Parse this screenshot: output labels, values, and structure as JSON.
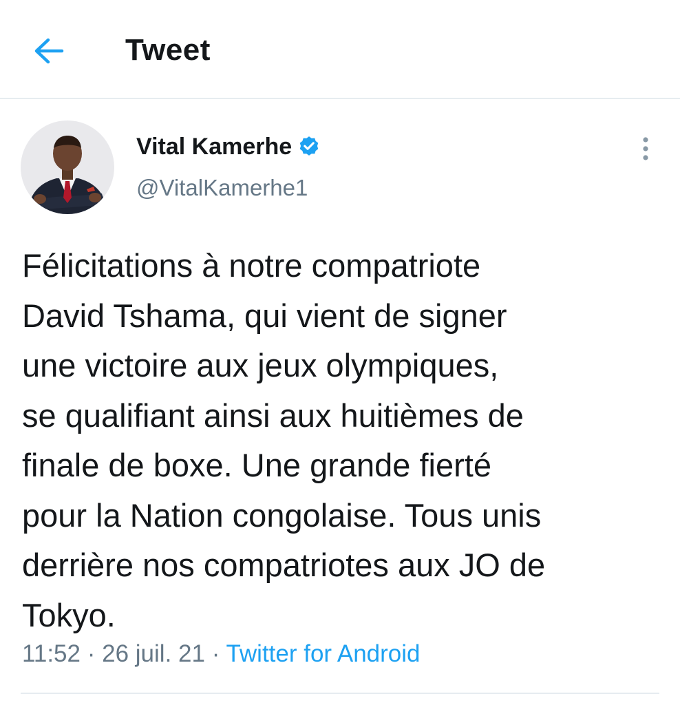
{
  "header": {
    "title": "Tweet",
    "back_icon": "arrow-left-icon"
  },
  "tweet": {
    "author_name": "Vital Kamerhe",
    "handle": "@VitalKamerhe1",
    "verified": true,
    "text_lines": [
      "Félicitations à notre compatriote",
      "David Tshama, qui vient de signer",
      "une victoire aux jeux olympiques,",
      "se qualifiant ainsi aux huitièmes de",
      "finale de boxe. Une grande fierté",
      "pour la Nation congolaise. Tous unis",
      "derrière nos compatriotes aux JO de",
      "Tokyo."
    ],
    "time": "11:52",
    "date": "26 juil. 21",
    "separator": "·",
    "source": "Twitter for Android"
  },
  "colors": {
    "accent": "#1da1f2",
    "text": "#14171a",
    "secondary": "#657786",
    "divider": "#e6ecf0"
  }
}
